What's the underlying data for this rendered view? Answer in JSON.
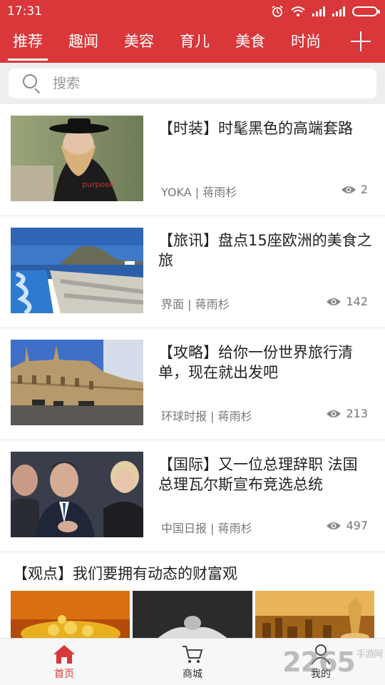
{
  "status_bar": {
    "time": "17:31"
  },
  "tabs": [
    {
      "label": "推荐",
      "active": true
    },
    {
      "label": "趣闻"
    },
    {
      "label": "美容"
    },
    {
      "label": "育儿"
    },
    {
      "label": "美食"
    },
    {
      "label": "时尚"
    }
  ],
  "search": {
    "placeholder": "搜索"
  },
  "articles": [
    {
      "title": "【时装】时髦黑色的高端套路",
      "source": "YOKA",
      "author": "蒋雨杉",
      "views": "2",
      "image": "fashion-woman-hat"
    },
    {
      "title": "【旅讯】盘点15座欧洲的美食之旅",
      "source": "界面",
      "author": "蒋雨杉",
      "views": "142",
      "image": "coastal-city"
    },
    {
      "title": "【攻略】给你一份世界旅行清单，现在就出发吧",
      "source": "环球时报",
      "author": "蒋雨杉",
      "views": "213",
      "image": "cathedral-square"
    },
    {
      "title": "【国际】又一位总理辞职 法国总理瓦尔斯宣布竞选总统",
      "source": "中国日报",
      "author": "蒋雨杉",
      "views": "497",
      "image": "politician-crowd"
    }
  ],
  "wide_article": {
    "title": "【观点】我们要拥有动态的财富观",
    "images": [
      "gold-coins",
      "hands-ball",
      "golden-city"
    ]
  },
  "bottom_nav": [
    {
      "label": "首页",
      "icon": "home-icon",
      "active": true
    },
    {
      "label": "商城",
      "icon": "cart-icon"
    },
    {
      "label": "我的",
      "icon": "user-icon"
    }
  ],
  "watermark": {
    "text": "2265",
    "suffix": "手游网"
  },
  "colors": {
    "brand_red": "#d9373a",
    "background": "#ffffff",
    "separator": "#eeeeee"
  }
}
